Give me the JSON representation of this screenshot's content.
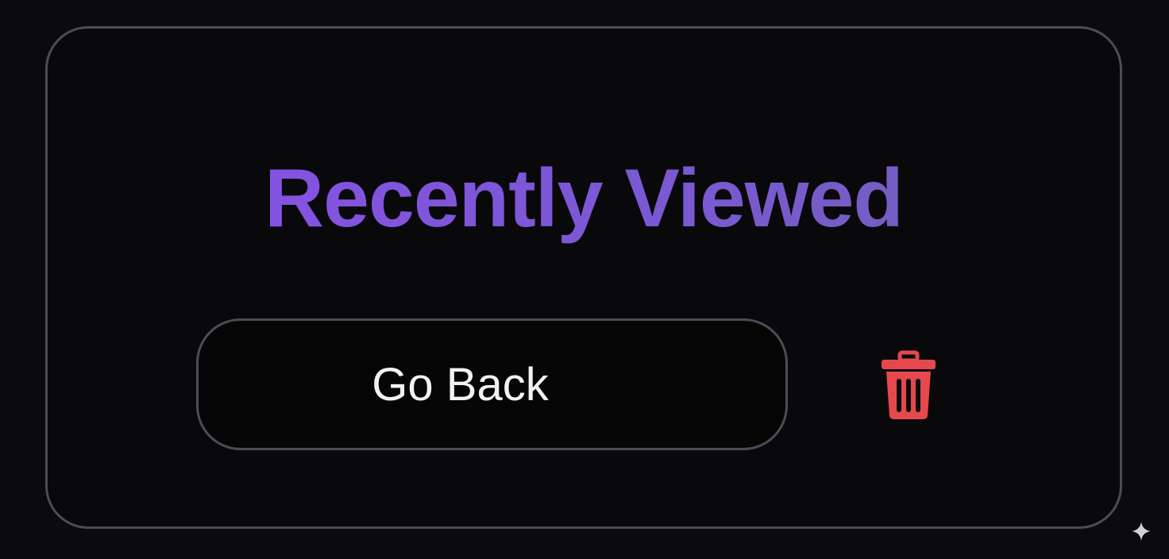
{
  "card": {
    "title": "Recently Viewed"
  },
  "actions": {
    "back_label": "Go Back",
    "delete_icon": "trash-icon"
  },
  "colors": {
    "background": "#0b0b0d",
    "border": "#4a4d55",
    "title_gradient_start": "#8a4fe8",
    "title_gradient_end": "#6e62b6",
    "button_text": "#f2f2f2",
    "delete": "#e5484d"
  }
}
